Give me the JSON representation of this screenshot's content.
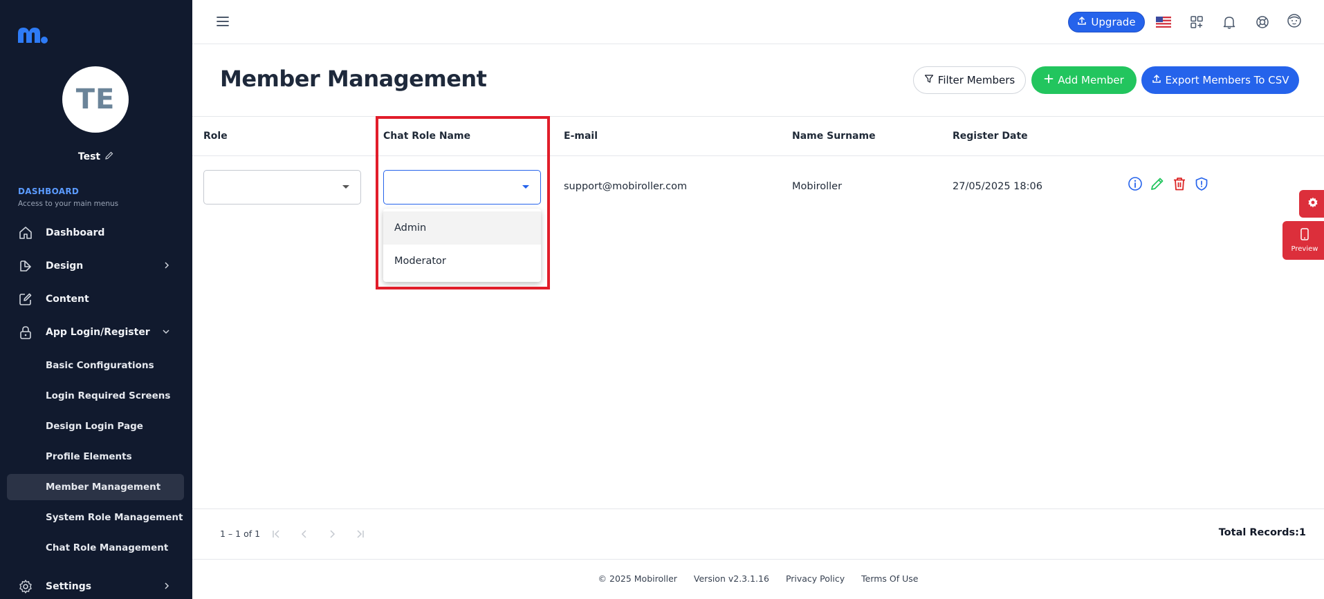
{
  "sidebar": {
    "avatar_initials": "TE",
    "username": "Test",
    "section_title": "DASHBOARD",
    "section_subtitle": "Access to your main menus",
    "items": [
      {
        "label": "Dashboard",
        "icon": "home-icon"
      },
      {
        "label": "Design",
        "icon": "design-icon"
      },
      {
        "label": "Content",
        "icon": "edit-icon"
      },
      {
        "label": "App Login/Register",
        "icon": "lock-icon"
      },
      {
        "label": "Settings",
        "icon": "gear-icon"
      }
    ],
    "sub_items": [
      {
        "label": "Basic Configurations"
      },
      {
        "label": "Login Required Screens"
      },
      {
        "label": "Design Login Page"
      },
      {
        "label": "Profile Elements"
      },
      {
        "label": "Member Management",
        "active": true
      },
      {
        "label": "System Role Management"
      },
      {
        "label": "Chat Role Management"
      }
    ]
  },
  "topbar": {
    "upgrade_label": "Upgrade"
  },
  "header": {
    "title": "Member Management",
    "filter_label": "Filter Members",
    "add_label": "Add Member",
    "export_label": "Export Members To CSV"
  },
  "table": {
    "columns": [
      "Role",
      "Chat Role Name",
      "E-mail",
      "Name Surname",
      "Register Date"
    ],
    "rows": [
      {
        "role": "",
        "chat_role": "",
        "email": "support@mobiroller.com",
        "name": "Mobiroller",
        "date": "27/05/2025 18:06"
      }
    ],
    "dropdown_options": [
      "Admin",
      "Moderator"
    ]
  },
  "floating": {
    "preview_label": "Preview"
  },
  "pager": {
    "range": "1 – 1 of 1",
    "total": "Total Records:1"
  },
  "footer": {
    "copyright": "© 2025 Mobiroller",
    "version": "Version v2.3.1.16",
    "privacy": "Privacy Policy",
    "terms": "Terms Of Use"
  },
  "colors": {
    "sidebar_bg": "#111a2e",
    "primary": "#2563eb",
    "success": "#22c55e",
    "danger": "#dc2f3b",
    "highlight": "#e11d2a"
  }
}
